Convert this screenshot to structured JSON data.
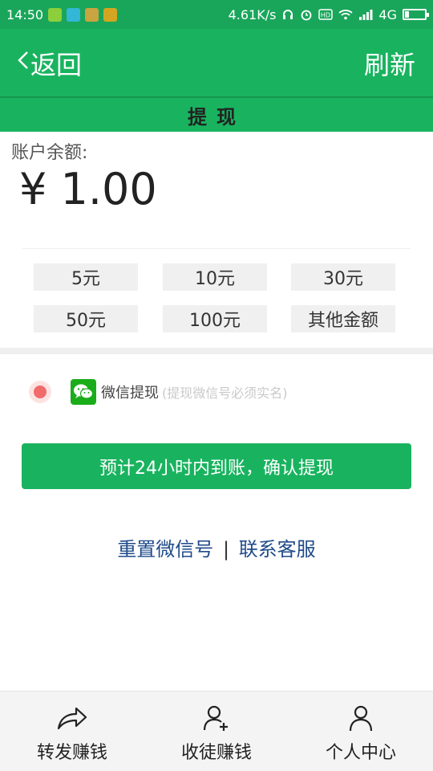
{
  "status_bar": {
    "time": "14:50",
    "speed": "4.61K/s",
    "network": "4G",
    "battery_level": 0.2,
    "app_icon_colors": [
      "#8ccf3a",
      "#34b6d6",
      "#c9a441",
      "#d4a520"
    ]
  },
  "nav": {
    "back_label": "返回",
    "refresh_label": "刷新"
  },
  "page": {
    "title": "提现"
  },
  "balance": {
    "label": "账户余额:",
    "value": "¥ 1.00"
  },
  "amounts": [
    "5元",
    "10元",
    "30元",
    "50元",
    "100元",
    "其他金额"
  ],
  "payment": {
    "method_label": "微信提现",
    "note": "(提现微信号必须实名)"
  },
  "confirm_label": "预计24小时内到账，确认提现",
  "links": {
    "reset": "重置微信号",
    "separator": "|",
    "contact": "联系客服"
  },
  "tabs": [
    {
      "label": "转发赚钱",
      "icon": "share-icon"
    },
    {
      "label": "收徒赚钱",
      "icon": "add-user-icon"
    },
    {
      "label": "个人中心",
      "icon": "user-icon"
    }
  ],
  "colors": {
    "brand_green": "#19b35f",
    "link_blue": "#1f4b8a",
    "radio_red": "#f26b6b"
  }
}
